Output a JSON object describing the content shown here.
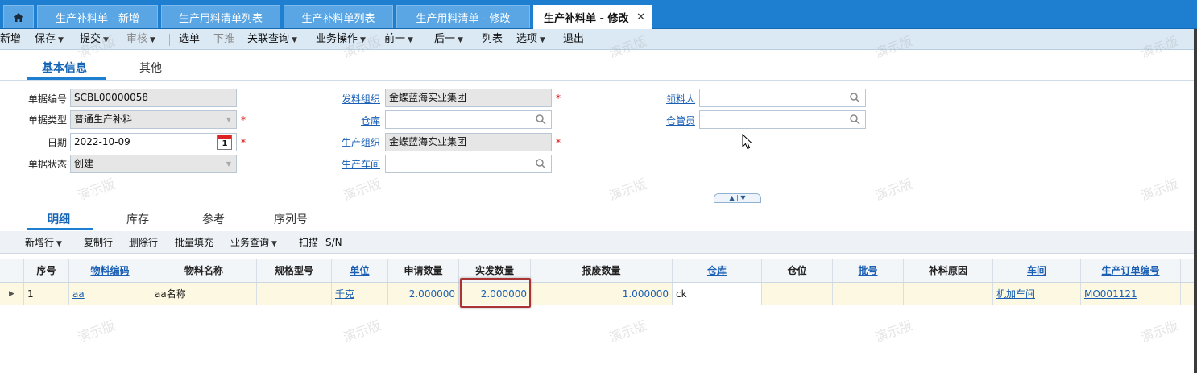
{
  "tabs": [
    {
      "label": "生产补料单 - 新增"
    },
    {
      "label": "生产用料清单列表"
    },
    {
      "label": "生产补料单列表"
    },
    {
      "label": "生产用料清单 - 修改"
    },
    {
      "label": "生产补料单 - 修改"
    }
  ],
  "toolbar": {
    "new": "新增",
    "save": "保存",
    "submit": "提交",
    "audit": "审核",
    "select": "选单",
    "push": "下推",
    "related": "关联查询",
    "business": "业务操作",
    "prev": "前一",
    "next": "后一",
    "list": "列表",
    "options": "选项",
    "exit": "退出"
  },
  "subtabs": {
    "basic": "基本信息",
    "other": "其他"
  },
  "form": {
    "bill_no_label": "单据编号",
    "bill_no": "SCBL00000058",
    "bill_type_label": "单据类型",
    "bill_type": "普通生产补料",
    "date_label": "日期",
    "date": "2022-10-09",
    "status_label": "单据状态",
    "status": "创建",
    "issue_org_label": "发料组织",
    "issue_org": "金蝶蓝海实业集团",
    "warehouse_label": "仓库",
    "warehouse": "",
    "prod_org_label": "生产组织",
    "prod_org": "金蝶蓝海实业集团",
    "workshop_label": "生产车间",
    "workshop": "",
    "picker_label": "领料人",
    "picker": "",
    "keeper_label": "仓管员",
    "keeper": "",
    "calendar_day": "1"
  },
  "gridtabs": {
    "detail": "明细",
    "stock": "库存",
    "ref": "参考",
    "serial": "序列号"
  },
  "gridtoolbar": {
    "add_row": "新增行",
    "copy_row": "复制行",
    "delete_row": "删除行",
    "batch_fill": "批量填充",
    "biz_query": "业务查询",
    "scan": "扫描",
    "sn": "S/N"
  },
  "grid": {
    "headers": [
      "序号",
      "物料编码",
      "物料名称",
      "规格型号",
      "单位",
      "申请数量",
      "实发数量",
      "报废数量",
      "仓库",
      "仓位",
      "批号",
      "补料原因",
      "车间",
      "生产订单编号"
    ],
    "row": {
      "seq": "1",
      "material_code": "aa",
      "material_name": "aa名称",
      "spec": "",
      "unit": "千克",
      "apply_qty": "2.000000",
      "actual_qty": "2.000000",
      "scrap_qty": "1.000000",
      "warehouse": "ck",
      "location": "",
      "lot": "",
      "reason": "",
      "workshop": "机加车间",
      "order_no": "MO001121"
    }
  },
  "watermark": "演示版",
  "colors": {
    "primary": "#1e7fd1",
    "highlight_border": "#a33333",
    "row_bg": "#fdf8e1"
  }
}
